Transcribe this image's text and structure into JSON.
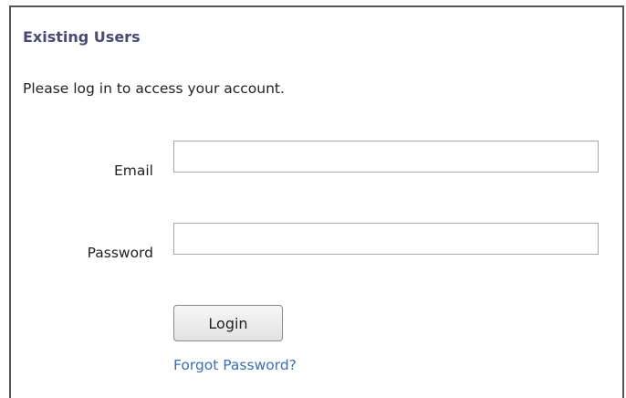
{
  "section": {
    "title": "Existing Users",
    "intro": "Please log in to access your account."
  },
  "form": {
    "email_label": "Email",
    "email_value": "",
    "password_label": "Password",
    "password_value": "",
    "login_button": "Login",
    "forgot_link": "Forgot Password?"
  },
  "colors": {
    "title": "#4a4a74",
    "link": "#3a6fb5",
    "border": "#555555"
  }
}
